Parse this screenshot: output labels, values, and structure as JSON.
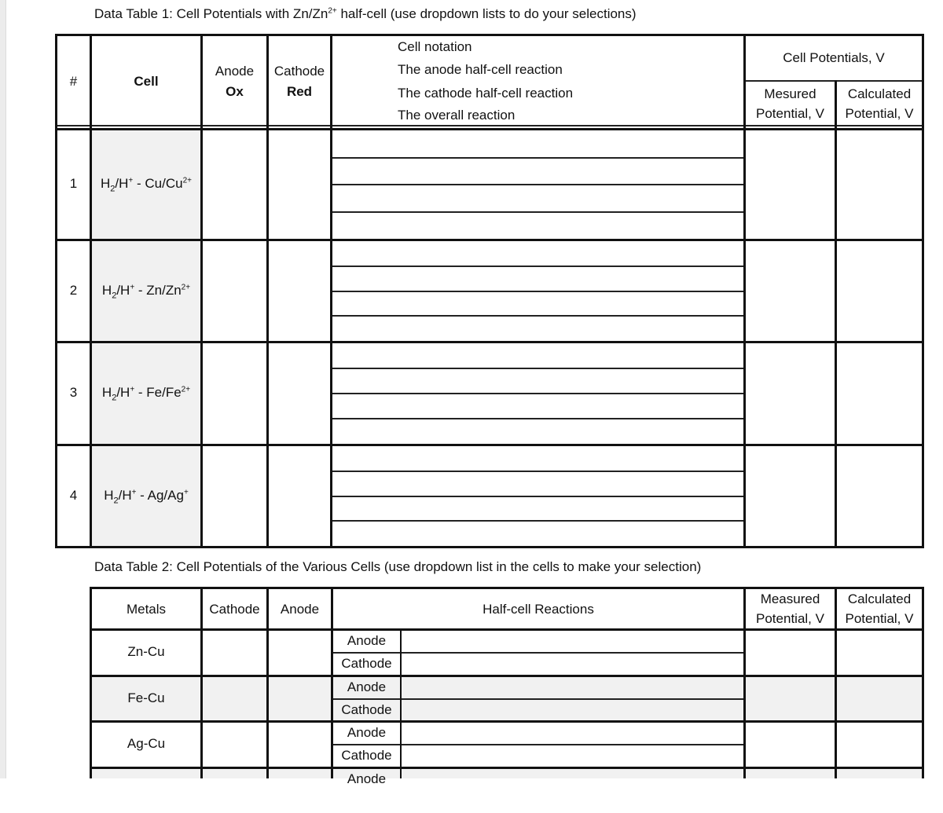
{
  "table1": {
    "title_pre": "Data Table 1: Cell Potentials with Zn/Zn",
    "title_sup": "2+",
    "title_post": " half-cell (use dropdown lists to do your selections)",
    "headers": {
      "num": "#",
      "cell": "Cell",
      "anode_top": "Anode",
      "anode_bottom": "Ox",
      "cathode_top": "Cathode",
      "cathode_bottom": "Red",
      "reaction_lines": [
        "Cell notation",
        "The anode half-cell  reaction",
        "The cathode half-cell  reaction",
        "The overall reaction"
      ],
      "potentials_group": "Cell Potentials, V",
      "measured_top": "Mesured",
      "measured_bottom": "Potential, V",
      "calculated_top": "Calculated",
      "calculated_bottom": "Potential, V"
    },
    "rows": [
      {
        "num": "1",
        "cell_a": "H",
        "cell_a_sub": "2",
        "cell_b": "/H",
        "cell_b_sup": "+",
        "cell_c": " - Cu/Cu",
        "cell_c_sup": "2+"
      },
      {
        "num": "2",
        "cell_a": "H",
        "cell_a_sub": "2",
        "cell_b": "/H",
        "cell_b_sup": "+",
        "cell_c": " - Zn/Zn",
        "cell_c_sup": "2+"
      },
      {
        "num": "3",
        "cell_a": "H",
        "cell_a_sub": "2",
        "cell_b": "/H",
        "cell_b_sup": "+",
        "cell_c": " - Fe/Fe",
        "cell_c_sup": "2+"
      },
      {
        "num": "4",
        "cell_a": "H",
        "cell_a_sub": "2",
        "cell_b": "/H",
        "cell_b_sup": "+",
        "cell_c": " - Ag/Ag",
        "cell_c_sup": "+"
      }
    ]
  },
  "table2": {
    "title": "Data Table 2: Cell Potentials of the Various Cells (use dropdown list in the cells to make your selection)",
    "headers": {
      "metals": "Metals",
      "cathode": "Cathode",
      "anode": "Anode",
      "reactions": "Half-cell Reactions",
      "measured_top": "Measured",
      "measured_bottom": "Potential, V",
      "calculated_top": "Calculated",
      "calculated_bottom": "Potential, V"
    },
    "rows": [
      {
        "metals": "Zn-Cu",
        "sub1": "Anode",
        "sub2": "Cathode"
      },
      {
        "metals": "Fe-Cu",
        "sub1": "Anode",
        "sub2": "Cathode"
      },
      {
        "metals": "Ag-Cu",
        "sub1": "Anode",
        "sub2": "Cathode"
      },
      {
        "metals": "",
        "sub1": "Anode",
        "sub2": ""
      }
    ]
  }
}
